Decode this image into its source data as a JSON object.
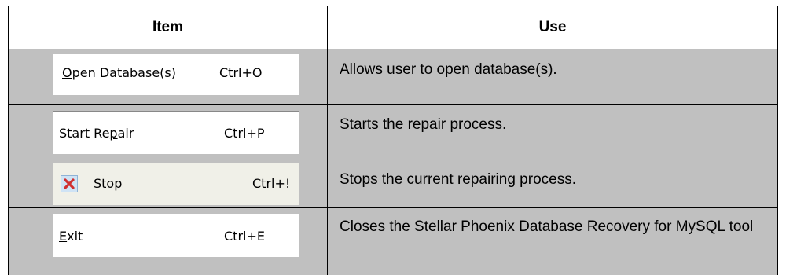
{
  "table": {
    "headers": {
      "item": "Item",
      "use": "Use"
    },
    "rows": [
      {
        "menu_label_pre": "",
        "menu_label_u": "O",
        "menu_label_post": "pen Database(s)",
        "shortcut": "Ctrl+O",
        "use": "Allows user to open database(s).",
        "icon": ""
      },
      {
        "menu_label_pre": "Start Re",
        "menu_label_u": "p",
        "menu_label_post": "air",
        "shortcut": "Ctrl+P",
        "use": "Starts the repair process.",
        "icon": ""
      },
      {
        "menu_label_pre": "",
        "menu_label_u": "S",
        "menu_label_post": "top",
        "shortcut": "Ctrl+!",
        "use": "Stops the current repairing process.",
        "icon": "stop-x-icon"
      },
      {
        "menu_label_pre": "",
        "menu_label_u": "E",
        "menu_label_post": "xit",
        "shortcut": "Ctrl+E",
        "use": "Closes the Stellar Phoenix Database Recovery for MySQL tool",
        "icon": ""
      }
    ]
  },
  "colors": {
    "row_bg": "#c0c0c0",
    "menu_bg": "#ffffff",
    "border": "#000000",
    "stop_icon_x": "#d03030"
  }
}
